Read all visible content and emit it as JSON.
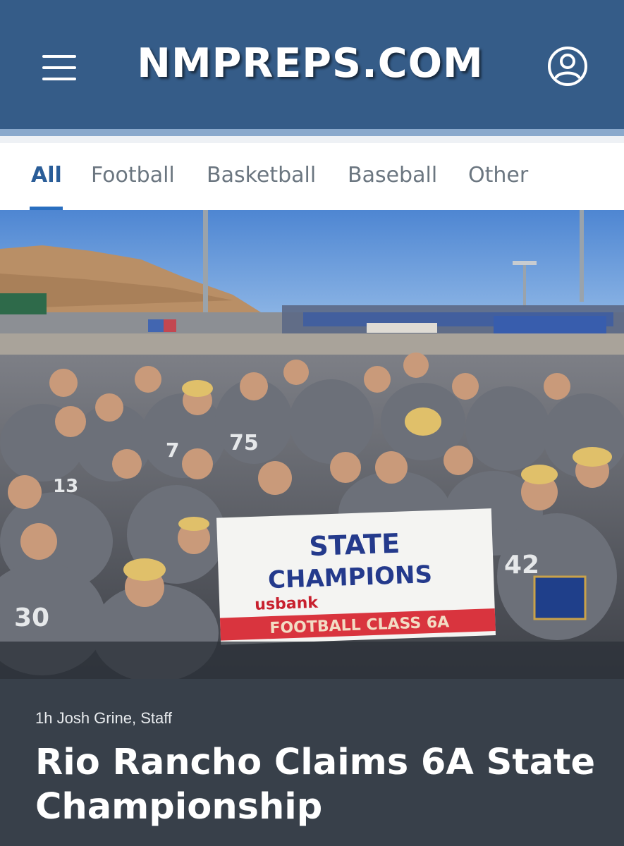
{
  "header": {
    "logo_text": "NMPREPS.COM",
    "bg_color": "#355c88",
    "menu_icon": "hamburger-menu-icon",
    "account_icon": "user-circle-icon"
  },
  "tabs": [
    {
      "label": "All",
      "active": true
    },
    {
      "label": "Football",
      "active": false
    },
    {
      "label": "Basketball",
      "active": false
    },
    {
      "label": "Baseball",
      "active": false
    },
    {
      "label": "Other",
      "active": false
    }
  ],
  "hero": {
    "banner_line1": "STATE",
    "banner_line2": "CHAMPIONS",
    "sponsor": "usbank",
    "banner_footer": "FOOTBALL  CLASS 6A",
    "jersey_numbers": [
      "75",
      "30",
      "42",
      "13",
      "7"
    ]
  },
  "article": {
    "meta": "1h Josh Grine, Staff",
    "headline": "Rio Rancho Claims 6A State Championship"
  }
}
